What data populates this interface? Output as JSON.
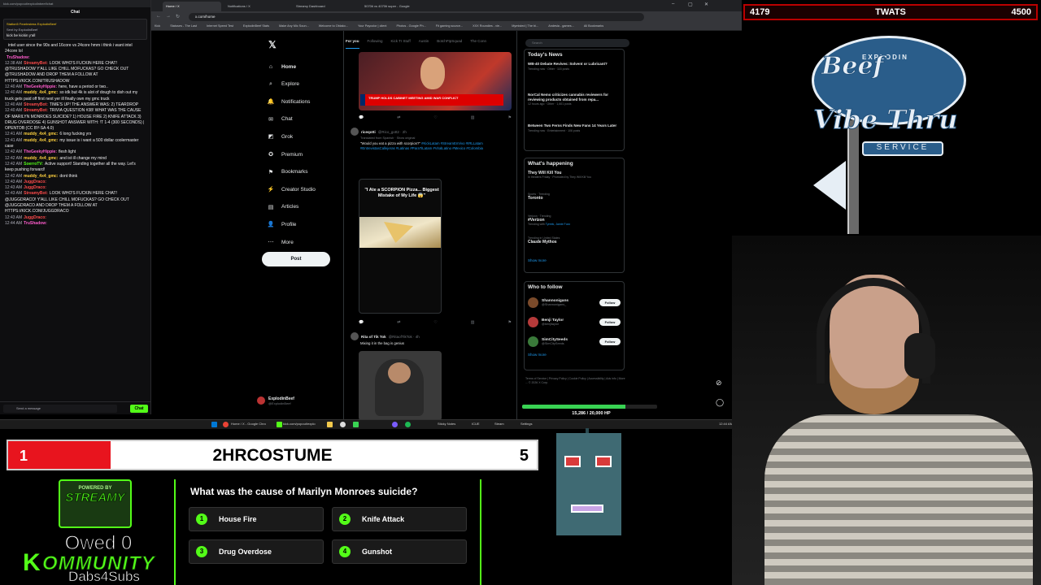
{
  "chat": {
    "url": "kick.com/popout/explodinbeef/chat",
    "title": "Chat",
    "pinned": {
      "gifts": "Station5   FearInstess   ExplodinBeef",
      "sent_by": "Sent by ExplodinBeef",
      "message": "kick be kickin y'all"
    },
    "lines": [
      {
        "time": "",
        "user": "",
        "color": "#efeff1",
        "text": "intel user since the 90s and 16core vs 24core hmm i think i want intel 24core lol"
      },
      {
        "time": "",
        "user": "TruShadow:",
        "color": "#ff5ccd",
        "text": ""
      },
      {
        "time": "12:38 AM",
        "user": "StreamyBot:",
        "color": "#ff4b4b",
        "text": "LOOK WHO'S FUCKIN HERE CHAT! @TRUSHADOW Y'ALL LIKE CHILL MOFUCKAS? GO CHECK OUT @TRUSHADOW AND DROP THEM A FOLLOW AT HTTPS://KICK.COM/TRUSHADOW"
      },
      {
        "time": "12:40 AM",
        "user": "TheGeekyHippie:",
        "color": "#ff5ccd",
        "text": "here, have a period or two.."
      },
      {
        "time": "12:40 AM",
        "user": "muddy_4x4_gmc:",
        "color": "#ffd23f",
        "text": "so idk but 4k is alot of dough to dish out my truck gets paid off first next yer ill finally own my gmc truck"
      },
      {
        "time": "12:40 AM",
        "user": "StreamyBot:",
        "color": "#ff4b4b",
        "text": "TIME'S UP! THE ANSWER WAS: 2) TEARDROP"
      },
      {
        "time": "12:40 AM",
        "user": "StreamyBot:",
        "color": "#ff4b4b",
        "text": "TRIVIA QUESTION #38! WHAT WAS THE CAUSE OF MARILYN MONROES SUICIDE? 1) HOUSE FIRE 2) KNIFE ATTACK 3) DRUG OVERDOSE 4) GUNSHOT ANSWER WITH: !T 1-4 (300 SECONDS) | OPENTDB (CC BY-SA 4.0)"
      },
      {
        "time": "12:41 AM",
        "user": "muddy_4x4_gmc:",
        "color": "#ffd23f",
        "text": "6 long fucking yrs"
      },
      {
        "time": "12:41 AM",
        "user": "muddy_4x4_gmc:",
        "color": "#ffd23f",
        "text": "my issue is i want a 500 dollar coolermaster case"
      },
      {
        "time": "12:42 AM",
        "user": "TheGeekyHippie:",
        "color": "#ff5ccd",
        "text": "flesh light"
      },
      {
        "time": "12:42 AM",
        "user": "muddy_4x4_gmc:",
        "color": "#ffd23f",
        "text": "and ist ill change my mind"
      },
      {
        "time": "12:42 AM",
        "user": "SoerroTV:",
        "color": "#53fc18",
        "text": "Active support! Standing together all the way. Let's keep pushing forward!"
      },
      {
        "time": "12:42 AM",
        "user": "muddy_4x4_gmc:",
        "color": "#ffd23f",
        "text": "dont think"
      },
      {
        "time": "12:43 AM",
        "user": "JuggDraco:",
        "color": "#ff4b4b",
        "text": ""
      },
      {
        "time": "12:43 AM",
        "user": "JuggDraco:",
        "color": "#ff4b4b",
        "text": ""
      },
      {
        "time": "12:43 AM",
        "user": "StreamyBot:",
        "color": "#ff4b4b",
        "text": "LOOK WHO'S FUCKIN HERE CHAT! @JUGGDRACO! Y'ALL LIKE CHILL MOFUCKAS? GO CHECK OUT @JUGGDRACO AND DROP THEM A FOLLOW AT HTTPS://KICK.COM/JUGGDRACO"
      },
      {
        "time": "12:43 AM",
        "user": "JuggDraco:",
        "color": "#ff4b4b",
        "text": ""
      },
      {
        "time": "12:44 AM",
        "user": "TruShadow:",
        "color": "#ff5ccd",
        "text": ""
      }
    ],
    "input_placeholder": "Send a message",
    "send_label": "Chat"
  },
  "browser": {
    "tabs": [
      {
        "label": "Home / X"
      },
      {
        "label": "Notifications / X"
      },
      {
        "label": "Streamy Dashboard"
      },
      {
        "label": "5070ti vs 4070ti super - Google"
      }
    ],
    "address": "x.com/home",
    "bookmarks": [
      "Kick",
      "Statuses - The Last",
      "Internet Speed Test",
      "ExplodinBeef Stats",
      "Make Any Mic Soun...",
      "Welcome to Oblako...",
      "Your Paycolor | client",
      "Photos - Google Ph...",
      "Fit gaming source...",
      "XXX Roundies - vie...",
      "Mymisted | The bi...",
      "Andesia - games...",
      "All Bookmarks"
    ]
  },
  "x_nav": {
    "items": [
      {
        "icon": "⌂",
        "label": "Home"
      },
      {
        "icon": "⌕",
        "label": "Explore"
      },
      {
        "icon": "🔔",
        "label": "Notifications"
      },
      {
        "icon": "✉",
        "label": "Chat"
      },
      {
        "icon": "◩",
        "label": "Grok"
      },
      {
        "icon": "✪",
        "label": "Premium"
      },
      {
        "icon": "⚑",
        "label": "Bookmarks"
      },
      {
        "icon": "⚡",
        "label": "Creator Studio"
      },
      {
        "icon": "▤",
        "label": "Articles"
      },
      {
        "icon": "👤",
        "label": "Profile"
      },
      {
        "icon": "⋯",
        "label": "More"
      }
    ],
    "post_label": "Post",
    "account_name": "ExplodinBeef",
    "account_handle": "@ExplodinBeef"
  },
  "timeline": {
    "tabs": [
      "For you",
      "Following",
      "Kick Tr Stuff",
      "Austin",
      "BotchFtpSquad",
      "The Conn"
    ],
    "news_banner": "TRUMP HOLDS CABINET MEETING AMID WAR CONFLICT",
    "tweet1": {
      "name": "riceqotti",
      "handle": "@Rico_gott2 · 2h",
      "translated": "Translated from Spanish · Show original",
      "text": "\"Would you eat a pizza with scorpion?\"",
      "tags": "#KickLatam #StreamEnVivo #IRLLatam #EntrevistasCallejeras #Latinas #ParaTiLatam #ViralLatino #Mexico #Colombia",
      "card_caption": "\"I Ate a SCORPION Pizza... Biggest Mistake of My Life 😱\""
    },
    "tweet2": {
      "name": "Rita of Tik Tok",
      "handle": "@RitaofTikTok · 4h",
      "text": "Mixing it in the bag is genius"
    }
  },
  "sidebar": {
    "search_placeholder": "Search",
    "todays_news": {
      "title": "Today's News",
      "items": [
        {
          "title": "WB-40 Debate Revives: Solvent or Lubricant?",
          "meta": "Trending now · Other · 115 posts"
        },
        {
          "title": "NorCal Nemo criticizes cannabis reviewers for reviewing products obtained from repa...",
          "meta": "12 hours ago · Other · 1,601 posts"
        },
        {
          "title": "Between Two Ferns Finds New Fans 14 Years Later",
          "meta": "Trending now · Entertainment · 106 posts"
        }
      ]
    },
    "happening": {
      "title": "What's happening",
      "trends": [
        {
          "context": "",
          "name": "They Will Kill You",
          "sub": "In theaters Friday · Promoted by They Will Kill You",
          "tag": ""
        },
        {
          "context": "Sports · Trending",
          "name": "Toronto",
          "sub": "",
          "tag": ""
        },
        {
          "context": "Verizon · Trending",
          "name": "#Verizon",
          "sub": "Trending with ",
          "tag": "Tyreek, Jamie Foxx"
        },
        {
          "context": "Trending in United States",
          "name": "Claude Mythos",
          "sub": "",
          "tag": ""
        }
      ],
      "show_more": "Show more"
    },
    "who_to_follow": {
      "title": "Who to follow",
      "accounts": [
        {
          "name": "Shannonigans",
          "handle": "@Shannonigans_",
          "button": "Follow",
          "color": "#7a4a2a"
        },
        {
          "name": "Benji Taylor",
          "handle": "@benjitaylor",
          "button": "Follow",
          "color": "#b53a3a"
        },
        {
          "name": "SimCitySeeds",
          "handle": "@SimCitySeeds",
          "button": "Follow",
          "color": "#3a7a3a"
        }
      ],
      "show_more": "Show more"
    },
    "footer": "Terms of Service | Privacy Policy | Cookie Policy | Accessibility | Ads info | More ... © 2026 X Corp."
  },
  "hp": {
    "text": "15,286 / 20,000 HP",
    "fraction": 0.7643
  },
  "taskbar": {
    "items": [
      "Home / X - Google Chro",
      "kick.com/popout/explo",
      "Sticky Notes",
      "ICUE",
      "Steam",
      "Settings"
    ],
    "clock": "12:44 AM"
  },
  "overlay": {
    "counter_value": "4179",
    "counter_label": "TWATS",
    "counter_goal": "4500",
    "quiz_bar_left": "1",
    "quiz_bar_word": "2HRCOSTUME",
    "quiz_bar_right": "5",
    "logo_top": "EXPLODIN",
    "logo_l1": "Beef",
    "logo_l2": "Vibe Thru",
    "logo_l3": "SERVICE",
    "badge_powered": "POWERED BY",
    "badge_name": "STREAMY",
    "owed": "Owed 0",
    "kommunity_k": "K",
    "kommunity_rest": "OMMUNITY",
    "dabs": "Dabs4Subs",
    "quiz": {
      "question": "What was the cause of Marilyn Monroes suicide?",
      "options": [
        {
          "n": "1",
          "label": "House Fire"
        },
        {
          "n": "2",
          "label": "Knife Attack"
        },
        {
          "n": "3",
          "label": "Drug Overdose"
        },
        {
          "n": "4",
          "label": "Gunshot"
        }
      ]
    }
  }
}
